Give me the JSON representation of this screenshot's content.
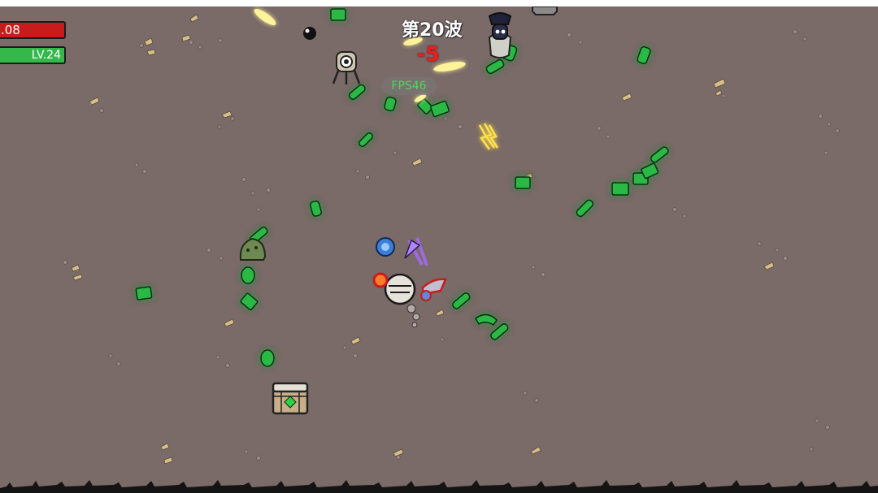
{
  "hud": {
    "health_text": ".08",
    "level_text": "LV.24",
    "xp_progress": 1.0,
    "wave_title": "第20波",
    "damage_popup": "-5",
    "fps_text": "FPS46"
  },
  "colors": {
    "ground": "#7a6a68",
    "health": "#c81c1c",
    "xp": "#35b84a",
    "material_glow": "#31d94a",
    "damage_text": "#ee1d1d",
    "fps_text": "#52d55e",
    "projectile": "#ffe96a"
  },
  "icons": {
    "player": "armored-potato-player",
    "enemies": [
      "hooded-sack-enemy",
      "one-eyed-tripod-enemy",
      "mossy-blob-enemy"
    ],
    "loot": "treasure-crate",
    "materials": "green-material-drop",
    "projectiles": "yellow-bullet"
  }
}
